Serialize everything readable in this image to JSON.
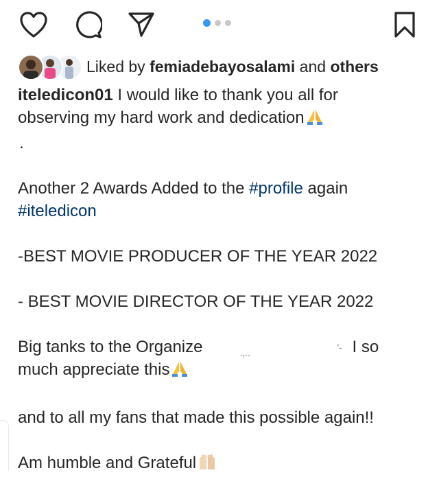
{
  "post": {
    "carousel": {
      "count": 3,
      "active": 0
    },
    "actions": {
      "like_icon": "heart-icon",
      "comment_icon": "comment-icon",
      "share_icon": "share-icon",
      "save_icon": "bookmark-icon"
    },
    "likes": {
      "prefix": "Liked by",
      "user": "femiadebayosalami",
      "joiner": "and",
      "others": "others"
    },
    "caption": {
      "username": "iteledicon01",
      "line1_text": " I would like to thank you all for",
      "line2_text": "observing my hard work and dedication",
      "dot_line": ".",
      "awards_line_a": "Another 2 Awards Added to the ",
      "awards_tag": "#profile",
      "awards_line_b": " again",
      "hashtag_line": "#iteledicon",
      "award_1": "-BEST MOVIE PRODUCER OF THE YEAR 2022",
      "award_2": "- BEST MOVIE DIRECTOR OF THE YEAR 2022",
      "thanks_a": "Big tanks to the Organize",
      "thanks_b": "I so",
      "thanks_line2": "much appreciate this",
      "fans_line": "and to all my fans that made this possible again!!",
      "humble_line": "Am humble and Grateful"
    },
    "colors": {
      "accent": "#3897f0",
      "hashtag": "#00376b",
      "text": "#262626"
    }
  }
}
